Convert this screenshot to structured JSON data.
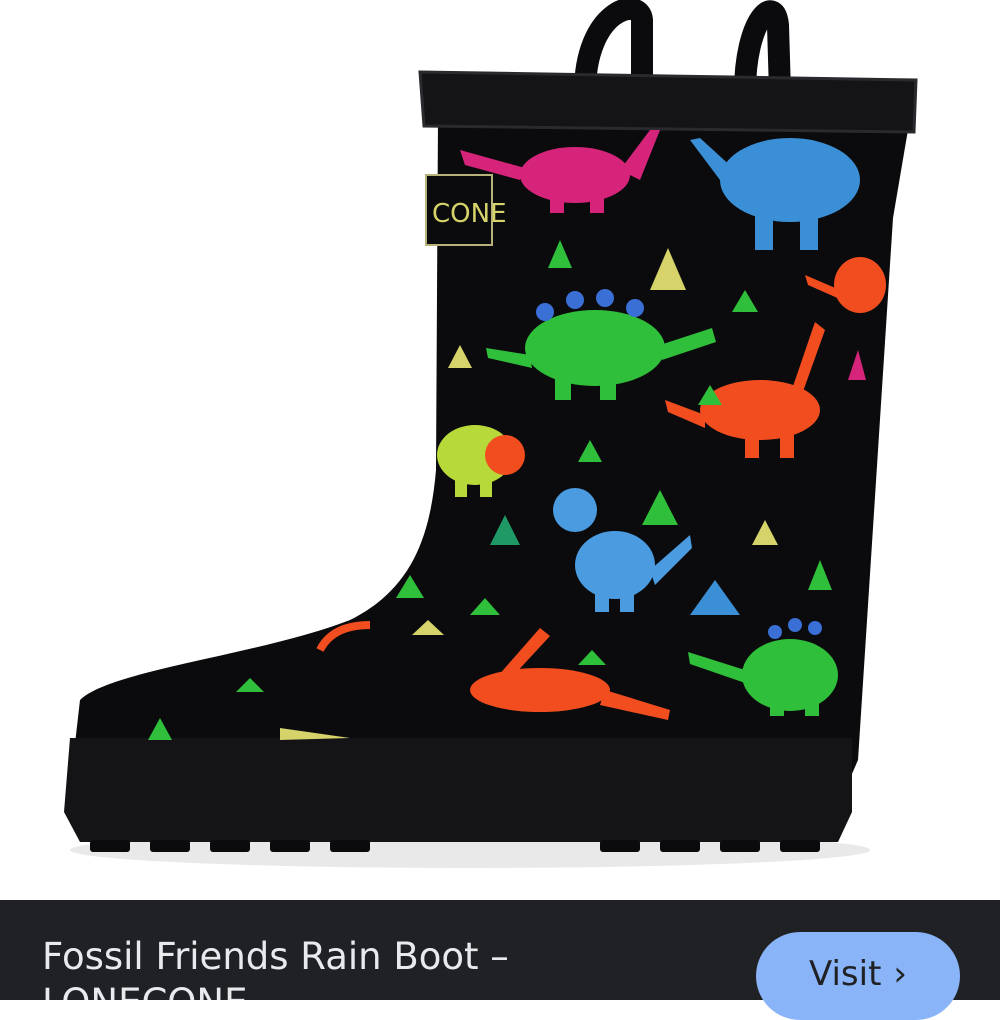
{
  "product": {
    "image_alt": "Kids black rain boot with colorful dinosaur print",
    "brand_label": "LONECONE",
    "brand_tag_visible": "CONE",
    "title": "Fossil Friends Rain Boot – LONECONE"
  },
  "actions": {
    "visit_label": "Visit",
    "visit_chevron": "›"
  },
  "colors": {
    "info_bar_bg": "#202124",
    "title_text": "#e8eaed",
    "visit_button_bg": "#8ab4f8",
    "boot_body": "#0b0b0d"
  }
}
